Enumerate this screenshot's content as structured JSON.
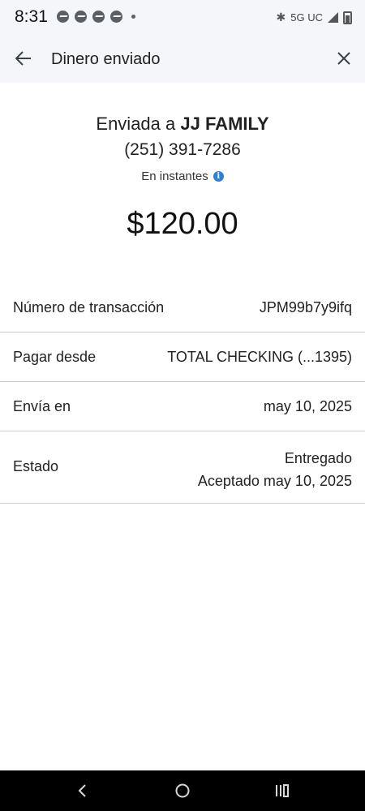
{
  "status_bar": {
    "time": "8:31",
    "network": "5G UC"
  },
  "header": {
    "title": "Dinero enviado",
    "back_icon": "arrow-left-icon",
    "close_icon": "close-icon"
  },
  "summary": {
    "sent_prefix": "Enviada a",
    "recipient": "JJ FAMILY",
    "phone": "(251) 391-7286",
    "timing": "En instantes",
    "amount": "$120.00"
  },
  "details": [
    {
      "label": "Número de transacción",
      "value": "JPM99b7y9ifq"
    },
    {
      "label": "Pagar desde",
      "value": "TOTAL CHECKING (...1395)"
    },
    {
      "label": "Envía en",
      "value": "may 10, 2025"
    },
    {
      "label": "Estado",
      "value_line1": "Entregado",
      "value_line2": "Aceptado may 10, 2025"
    }
  ],
  "colors": {
    "header_bg": "#f4f6f9",
    "divider": "#c9ced4",
    "info_icon": "#2f80d1"
  }
}
